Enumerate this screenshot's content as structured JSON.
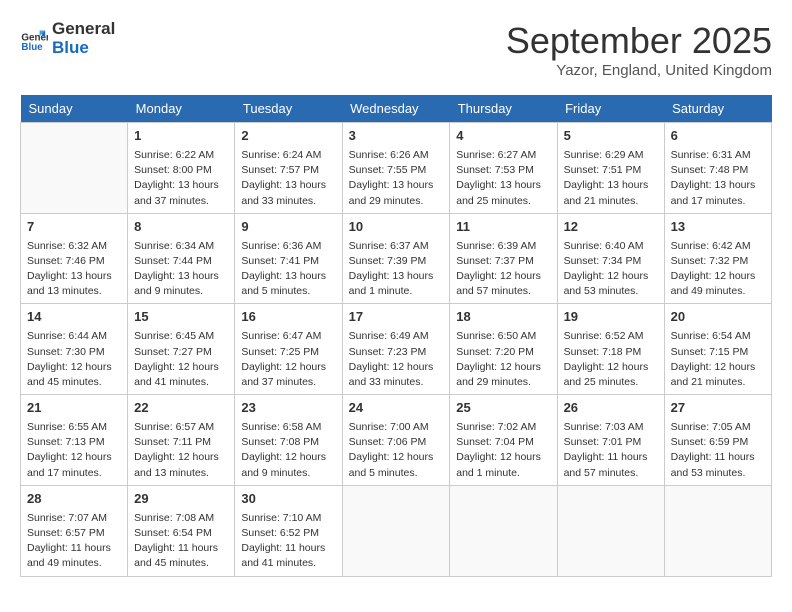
{
  "header": {
    "logo_line1": "General",
    "logo_line2": "Blue",
    "month": "September 2025",
    "location": "Yazor, England, United Kingdom"
  },
  "weekdays": [
    "Sunday",
    "Monday",
    "Tuesday",
    "Wednesday",
    "Thursday",
    "Friday",
    "Saturday"
  ],
  "weeks": [
    [
      {
        "day": "",
        "info": ""
      },
      {
        "day": "1",
        "info": "Sunrise: 6:22 AM\nSunset: 8:00 PM\nDaylight: 13 hours\nand 37 minutes."
      },
      {
        "day": "2",
        "info": "Sunrise: 6:24 AM\nSunset: 7:57 PM\nDaylight: 13 hours\nand 33 minutes."
      },
      {
        "day": "3",
        "info": "Sunrise: 6:26 AM\nSunset: 7:55 PM\nDaylight: 13 hours\nand 29 minutes."
      },
      {
        "day": "4",
        "info": "Sunrise: 6:27 AM\nSunset: 7:53 PM\nDaylight: 13 hours\nand 25 minutes."
      },
      {
        "day": "5",
        "info": "Sunrise: 6:29 AM\nSunset: 7:51 PM\nDaylight: 13 hours\nand 21 minutes."
      },
      {
        "day": "6",
        "info": "Sunrise: 6:31 AM\nSunset: 7:48 PM\nDaylight: 13 hours\nand 17 minutes."
      }
    ],
    [
      {
        "day": "7",
        "info": "Sunrise: 6:32 AM\nSunset: 7:46 PM\nDaylight: 13 hours\nand 13 minutes."
      },
      {
        "day": "8",
        "info": "Sunrise: 6:34 AM\nSunset: 7:44 PM\nDaylight: 13 hours\nand 9 minutes."
      },
      {
        "day": "9",
        "info": "Sunrise: 6:36 AM\nSunset: 7:41 PM\nDaylight: 13 hours\nand 5 minutes."
      },
      {
        "day": "10",
        "info": "Sunrise: 6:37 AM\nSunset: 7:39 PM\nDaylight: 13 hours\nand 1 minute."
      },
      {
        "day": "11",
        "info": "Sunrise: 6:39 AM\nSunset: 7:37 PM\nDaylight: 12 hours\nand 57 minutes."
      },
      {
        "day": "12",
        "info": "Sunrise: 6:40 AM\nSunset: 7:34 PM\nDaylight: 12 hours\nand 53 minutes."
      },
      {
        "day": "13",
        "info": "Sunrise: 6:42 AM\nSunset: 7:32 PM\nDaylight: 12 hours\nand 49 minutes."
      }
    ],
    [
      {
        "day": "14",
        "info": "Sunrise: 6:44 AM\nSunset: 7:30 PM\nDaylight: 12 hours\nand 45 minutes."
      },
      {
        "day": "15",
        "info": "Sunrise: 6:45 AM\nSunset: 7:27 PM\nDaylight: 12 hours\nand 41 minutes."
      },
      {
        "day": "16",
        "info": "Sunrise: 6:47 AM\nSunset: 7:25 PM\nDaylight: 12 hours\nand 37 minutes."
      },
      {
        "day": "17",
        "info": "Sunrise: 6:49 AM\nSunset: 7:23 PM\nDaylight: 12 hours\nand 33 minutes."
      },
      {
        "day": "18",
        "info": "Sunrise: 6:50 AM\nSunset: 7:20 PM\nDaylight: 12 hours\nand 29 minutes."
      },
      {
        "day": "19",
        "info": "Sunrise: 6:52 AM\nSunset: 7:18 PM\nDaylight: 12 hours\nand 25 minutes."
      },
      {
        "day": "20",
        "info": "Sunrise: 6:54 AM\nSunset: 7:15 PM\nDaylight: 12 hours\nand 21 minutes."
      }
    ],
    [
      {
        "day": "21",
        "info": "Sunrise: 6:55 AM\nSunset: 7:13 PM\nDaylight: 12 hours\nand 17 minutes."
      },
      {
        "day": "22",
        "info": "Sunrise: 6:57 AM\nSunset: 7:11 PM\nDaylight: 12 hours\nand 13 minutes."
      },
      {
        "day": "23",
        "info": "Sunrise: 6:58 AM\nSunset: 7:08 PM\nDaylight: 12 hours\nand 9 minutes."
      },
      {
        "day": "24",
        "info": "Sunrise: 7:00 AM\nSunset: 7:06 PM\nDaylight: 12 hours\nand 5 minutes."
      },
      {
        "day": "25",
        "info": "Sunrise: 7:02 AM\nSunset: 7:04 PM\nDaylight: 12 hours\nand 1 minute."
      },
      {
        "day": "26",
        "info": "Sunrise: 7:03 AM\nSunset: 7:01 PM\nDaylight: 11 hours\nand 57 minutes."
      },
      {
        "day": "27",
        "info": "Sunrise: 7:05 AM\nSunset: 6:59 PM\nDaylight: 11 hours\nand 53 minutes."
      }
    ],
    [
      {
        "day": "28",
        "info": "Sunrise: 7:07 AM\nSunset: 6:57 PM\nDaylight: 11 hours\nand 49 minutes."
      },
      {
        "day": "29",
        "info": "Sunrise: 7:08 AM\nSunset: 6:54 PM\nDaylight: 11 hours\nand 45 minutes."
      },
      {
        "day": "30",
        "info": "Sunrise: 7:10 AM\nSunset: 6:52 PM\nDaylight: 11 hours\nand 41 minutes."
      },
      {
        "day": "",
        "info": ""
      },
      {
        "day": "",
        "info": ""
      },
      {
        "day": "",
        "info": ""
      },
      {
        "day": "",
        "info": ""
      }
    ]
  ]
}
